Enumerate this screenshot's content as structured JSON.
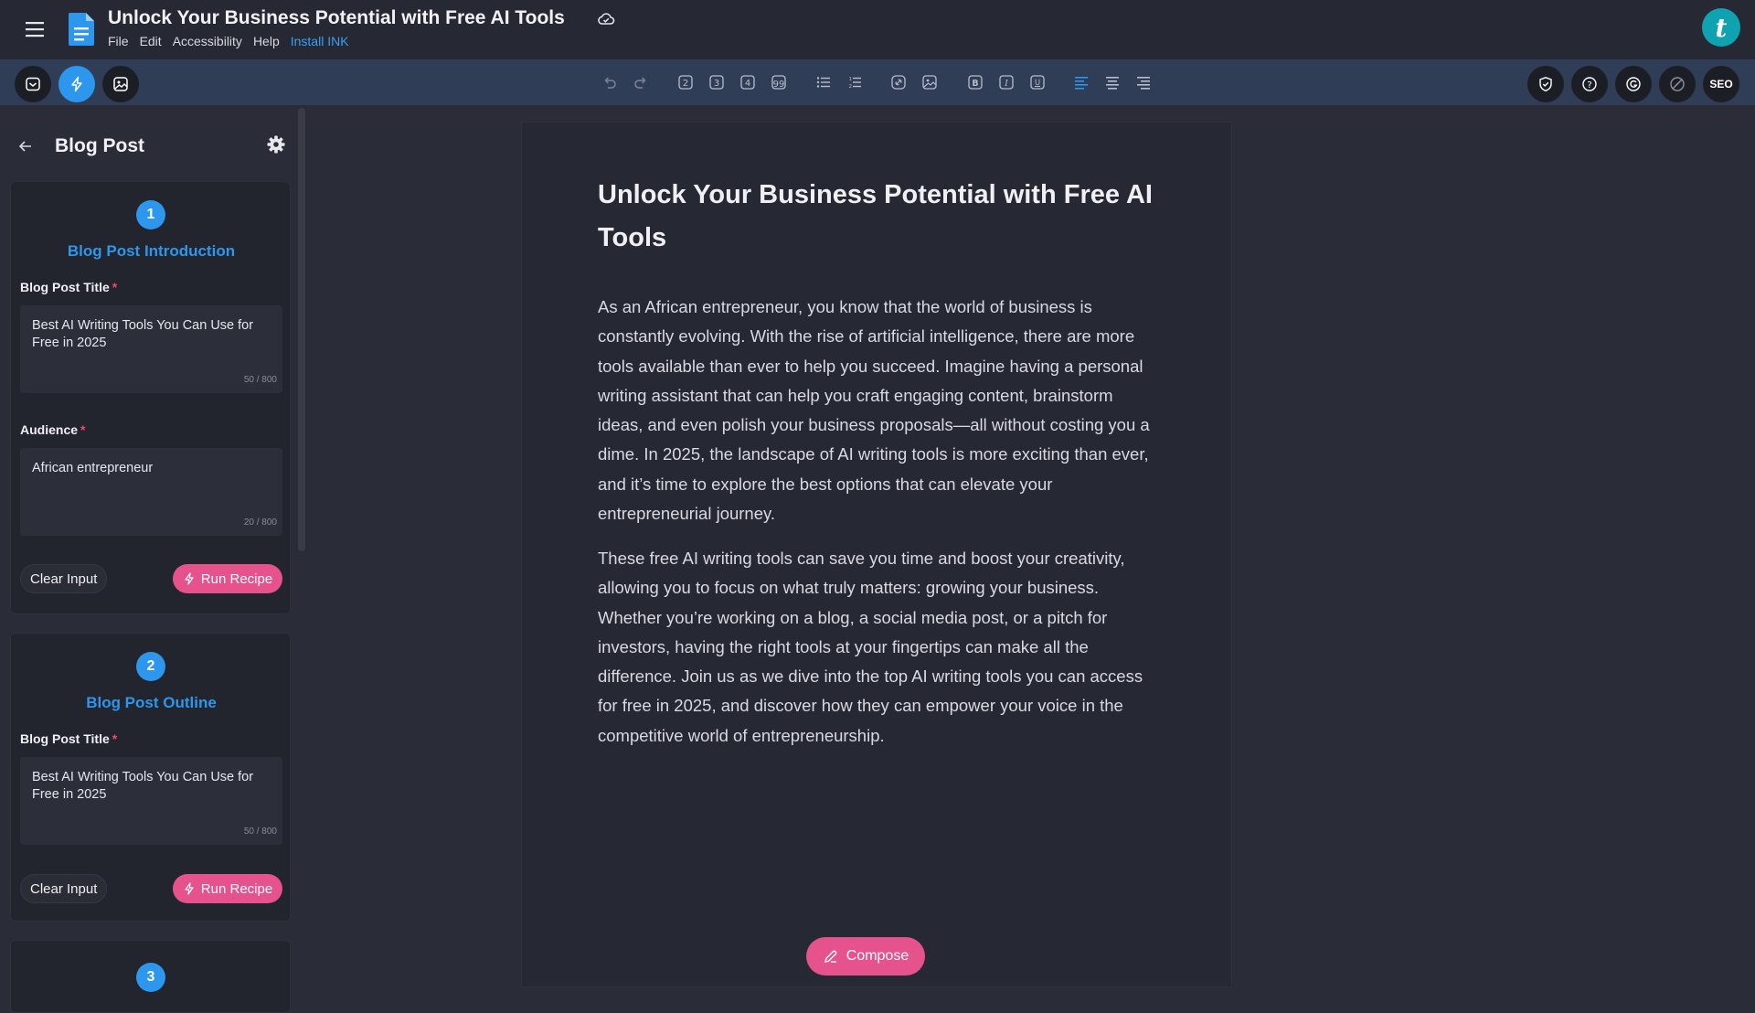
{
  "header": {
    "doc_title": "Unlock Your Business Potential with Free AI Tools",
    "menu": [
      "File",
      "Edit",
      "Accessibility",
      "Help"
    ],
    "install_link": "Install INK",
    "avatar_letter": "t"
  },
  "toolbar": {
    "left_icons": [
      "inbox-icon",
      "lightning-icon",
      "image-edit-icon"
    ],
    "format_icons": [
      "undo-icon",
      "redo-icon",
      "heading-2-icon",
      "heading-3-icon",
      "heading-4-icon",
      "quote-icon",
      "bullet-list-icon",
      "numbered-list-icon",
      "link-icon",
      "image-icon",
      "bold-icon",
      "italic-icon",
      "underline-icon",
      "align-left-icon",
      "align-center-icon",
      "align-right-icon"
    ],
    "right_icons": [
      "shield-check-icon",
      "help-icon",
      "grammar-icon",
      "disable-icon"
    ],
    "seo_label": "SEO",
    "accent": "#2c97ec"
  },
  "sidebar": {
    "title": "Blog Post",
    "cards": [
      {
        "step": "1",
        "title": "Blog Post Introduction",
        "fields": [
          {
            "label": "Blog Post Title",
            "value": "Best AI Writing Tools You Can Use for Free in 2025",
            "counter": "50 / 800"
          },
          {
            "label": "Audience",
            "value": "African entrepreneur",
            "counter": "20 / 800"
          }
        ],
        "clear_label": "Clear Input",
        "run_label": "Run Recipe"
      },
      {
        "step": "2",
        "title": "Blog Post Outline",
        "fields": [
          {
            "label": "Blog Post Title",
            "value": "Best AI Writing Tools You Can Use for Free in 2025",
            "counter": "50 / 800"
          }
        ],
        "clear_label": "Clear Input",
        "run_label": "Run Recipe"
      },
      {
        "step": "3"
      }
    ]
  },
  "document": {
    "heading": "Unlock Your Business Potential with Free AI Tools",
    "paragraphs": [
      "As an African entrepreneur, you know that the world of business is constantly evolving. With the rise of artificial intelligence, there are more tools available than ever to help you succeed. Imagine having a personal writing assistant that can help you craft engaging content, brainstorm ideas, and even polish your business proposals—all without costing you a dime. In 2025, the landscape of AI writing tools is more exciting than ever, and it’s time to explore the best options that can elevate your entrepreneurial journey.",
      "These free AI writing tools can save you time and boost your creativity, allowing you to focus on what truly matters: growing your business. Whether you’re working on a blog, a social media post, or a pitch for investors, having the right tools at your fingertips can make all the difference. Join us as we dive into the top AI writing tools you can access for free in 2025, and discover how they can empower your voice in the competitive world of entrepreneurship."
    ],
    "compose_label": "Compose"
  }
}
